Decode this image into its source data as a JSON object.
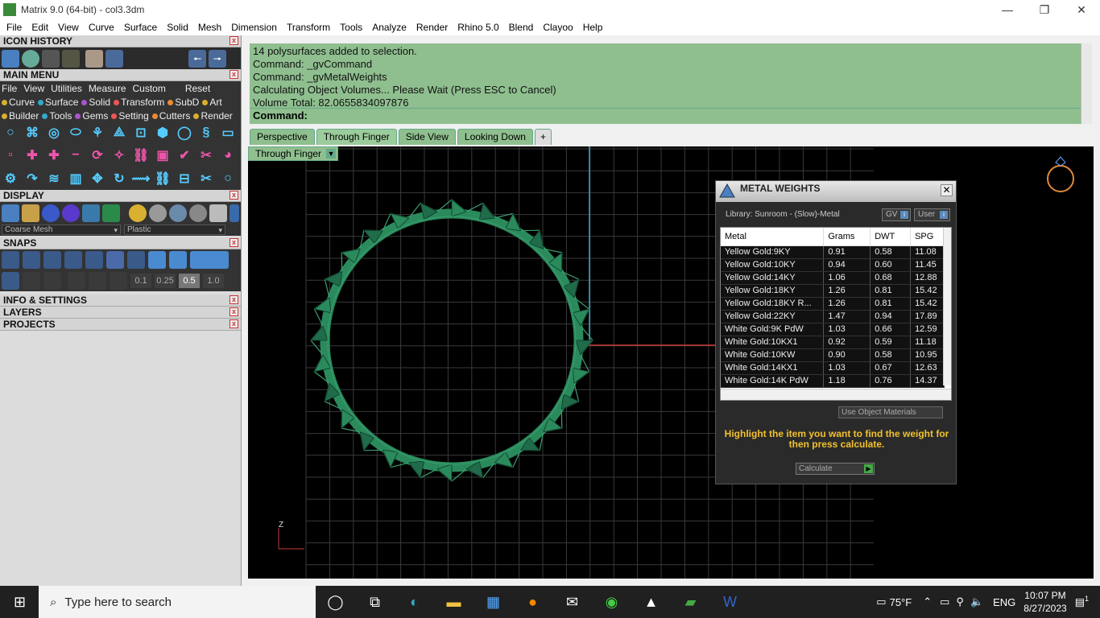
{
  "window": {
    "title": "Matrix 9.0 (64-bit) - col3.3dm"
  },
  "menubar": [
    "File",
    "Edit",
    "View",
    "Curve",
    "Surface",
    "Solid",
    "Mesh",
    "Dimension",
    "Transform",
    "Tools",
    "Analyze",
    "Render",
    "Rhino 5.0",
    "Blend",
    "Clayoo",
    "Help"
  ],
  "panels": {
    "icon_history": "ICON HISTORY",
    "main_menu": "MAIN MENU",
    "display": "DISPLAY",
    "snaps": "SNAPS",
    "info_settings": "INFO & SETTINGS",
    "layers": "LAYERS",
    "projects": "PROJECTS"
  },
  "main_menu_items": [
    "File",
    "View",
    "Utilities",
    "Measure",
    "Custom",
    "Reset"
  ],
  "categories_row1": [
    "Curve",
    "Surface",
    "Solid",
    "Transform",
    "SubD",
    "Art"
  ],
  "categories_row2": [
    "Builder",
    "Tools",
    "Gems",
    "Setting",
    "Cutters",
    "Render"
  ],
  "display": {
    "mesh_select": "Coarse Mesh",
    "material_select": "Plastic"
  },
  "snaps": {
    "values": [
      "0.1",
      "0.25",
      "0.5",
      "1.0"
    ]
  },
  "command": {
    "history": [
      "14 polysurfaces added to selection.",
      "Command: _gvCommand",
      "Command: _gvMetalWeights",
      "Calculating Object Volumes... Please Wait (Press ESC to Cancel)",
      "Volume Total: 82.0655834097876"
    ],
    "prompt": "Command:"
  },
  "viewport_tabs": [
    "Perspective",
    "Through Finger",
    "Side View",
    "Looking Down"
  ],
  "viewport": {
    "label": "Through Finger",
    "axis_label": "Z"
  },
  "metal_weights": {
    "title": "METAL WEIGHTS",
    "library": "Library: Sunroom - (Slow)-Metal",
    "btn_gv": "GV",
    "btn_user": "User",
    "columns": [
      "Metal",
      "Grams",
      "DWT",
      "SPG"
    ],
    "rows": [
      [
        "Yellow Gold:9KY",
        "0.91",
        "0.58",
        "11.08"
      ],
      [
        "Yellow Gold:10KY",
        "0.94",
        "0.60",
        "11.45"
      ],
      [
        "Yellow Gold:14KY",
        "1.06",
        "0.68",
        "12.88"
      ],
      [
        "Yellow Gold:18KY",
        "1.26",
        "0.81",
        "15.42"
      ],
      [
        "Yellow Gold:18KY R...",
        "1.26",
        "0.81",
        "15.42"
      ],
      [
        "Yellow Gold:22KY",
        "1.47",
        "0.94",
        "17.89"
      ],
      [
        "White Gold:9K PdW",
        "1.03",
        "0.66",
        "12.59"
      ],
      [
        "White Gold:10KX1",
        "0.92",
        "0.59",
        "11.18"
      ],
      [
        "White Gold:10KW",
        "0.90",
        "0.58",
        "10.95"
      ],
      [
        "White Gold:14KX1",
        "1.03",
        "0.67",
        "12.63"
      ],
      [
        "White Gold:14K PdW",
        "1.18",
        "0.76",
        "14.37"
      ]
    ],
    "use_object_materials": "Use Object Materials",
    "message": "Highlight the item you want to find the weight for then press calculate.",
    "calculate": "Calculate"
  },
  "taskbar": {
    "search_placeholder": "Type here to search",
    "weather": "75°F",
    "lang": "ENG",
    "time": "10:07 PM",
    "date": "8/27/2023",
    "notif_count": "1"
  }
}
